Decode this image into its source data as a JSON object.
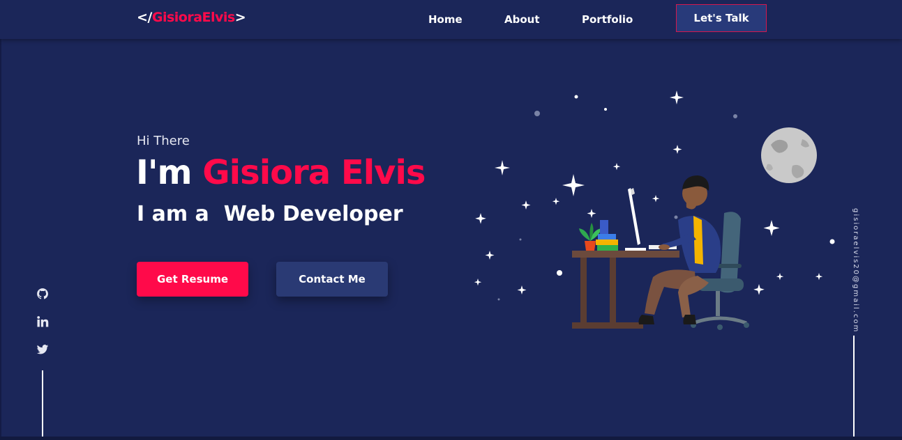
{
  "logo": {
    "open": "</",
    "brand": "GisioraElvis",
    "close": ">"
  },
  "nav": {
    "home": "Home",
    "about": "About",
    "portfolio": "Portfolio",
    "cta": "Let's Talk"
  },
  "hero": {
    "greeting": "Hi There",
    "headline_prefix": "I'm ",
    "headline_name": "Gisiora Elvis",
    "role": "I am a  Web Developer",
    "resume_button": "Get Resume",
    "contact_button": "Contact Me"
  },
  "social": [
    "github-icon",
    "linkedin-icon",
    "twitter-icon"
  ],
  "email": "gisioraelvis20@gmail.com",
  "colors": {
    "background": "#1b2659",
    "accent": "#ff0a4a",
    "secondary_button": "#2a3a74"
  }
}
